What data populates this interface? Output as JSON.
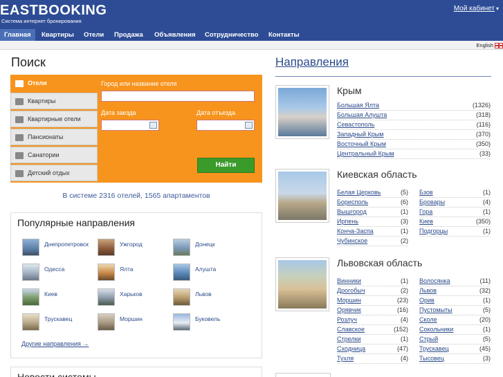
{
  "header": {
    "logo": "EASTBOOKING",
    "tagline": "Система интернет бронирования",
    "cabinet": "Мой кабинет",
    "cabinet_arrow": "▾"
  },
  "nav": [
    "Главная",
    "Квартиры",
    "Отели",
    "Продажа",
    "Объявления",
    "Сотрудничество",
    "Контакты"
  ],
  "lang": "English",
  "search": {
    "title": "Поиск",
    "tabs": [
      "Отели",
      "Квартиры",
      "Квартирные отели",
      "Пансионаты",
      "Санатории",
      "Детский отдых"
    ],
    "city_label": "Город или название отеля",
    "city_value": "",
    "checkin_label": "Дата заезда",
    "checkout_label": "Дата отъезда",
    "checkin_value": "",
    "checkout_value": "",
    "button": "Найти",
    "stats": "В системе 2316 отелей, 1565 апартаментов"
  },
  "popular": {
    "title": "Популярные направления",
    "items": [
      "Днепропетровск",
      "Ужгород",
      "Донецк",
      "Одесса",
      "Ялта",
      "Алушта",
      "Киев",
      "Харьков",
      "Львов",
      "Трускавец",
      "Моршин",
      "Буковель"
    ],
    "more": "Другие направления →"
  },
  "news": {
    "title": "Новости системы"
  },
  "directions": {
    "title": "Направления",
    "regions": [
      {
        "name": "Крым",
        "left": [
          {
            "city": "Большая Ялта",
            "count": "(1326)"
          },
          {
            "city": "Большая Алушта",
            "count": "(318)"
          },
          {
            "city": "Севастополь",
            "count": "(116)"
          },
          {
            "city": "Западный Крым",
            "count": "(370)"
          },
          {
            "city": "Восточный Крым",
            "count": "(350)"
          },
          {
            "city": "Центральный Крым",
            "count": "(33)"
          }
        ],
        "right": []
      },
      {
        "name": "Киевская область",
        "left": [
          {
            "city": "Белая Церковь",
            "count": "(5)"
          },
          {
            "city": "Борисполь",
            "count": "(6)"
          },
          {
            "city": "Вышгород",
            "count": "(1)"
          },
          {
            "city": "Ирпень",
            "count": "(3)"
          },
          {
            "city": "Конча-Заспа",
            "count": "(1)"
          },
          {
            "city": "Чубинское",
            "count": "(2)"
          }
        ],
        "right": [
          {
            "city": "Бзов",
            "count": "(1)"
          },
          {
            "city": "Бровары",
            "count": "(4)"
          },
          {
            "city": "Гора",
            "count": "(1)"
          },
          {
            "city": "Киев",
            "count": "(350)"
          },
          {
            "city": "Подгорцы",
            "count": "(1)"
          }
        ]
      },
      {
        "name": "Львовская область",
        "left": [
          {
            "city": "Винники",
            "count": "(1)"
          },
          {
            "city": "Дрогобыч",
            "count": "(2)"
          },
          {
            "city": "Моршин",
            "count": "(23)"
          },
          {
            "city": "Орявчик",
            "count": "(16)"
          },
          {
            "city": "Розлуч",
            "count": "(4)"
          },
          {
            "city": "Славское",
            "count": "(152)"
          },
          {
            "city": "Стрелки",
            "count": "(1)"
          },
          {
            "city": "Сходница",
            "count": "(47)"
          },
          {
            "city": "Тухля",
            "count": "(4)"
          }
        ],
        "right": [
          {
            "city": "Волосянка",
            "count": "(11)"
          },
          {
            "city": "Львов",
            "count": "(32)"
          },
          {
            "city": "Орив",
            "count": "(1)"
          },
          {
            "city": "Пустомыты",
            "count": "(5)"
          },
          {
            "city": "Сколе",
            "count": "(20)"
          },
          {
            "city": "Сокольники",
            "count": "(1)"
          },
          {
            "city": "Стрый",
            "count": "(5)"
          },
          {
            "city": "Трускавец",
            "count": "(45)"
          },
          {
            "city": "Тысовец",
            "count": "(3)"
          }
        ]
      }
    ]
  },
  "colors": {
    "header": "#2d4c95",
    "orange": "#f7941d",
    "link": "#2a4a8a",
    "button": "#3a9a2a"
  }
}
